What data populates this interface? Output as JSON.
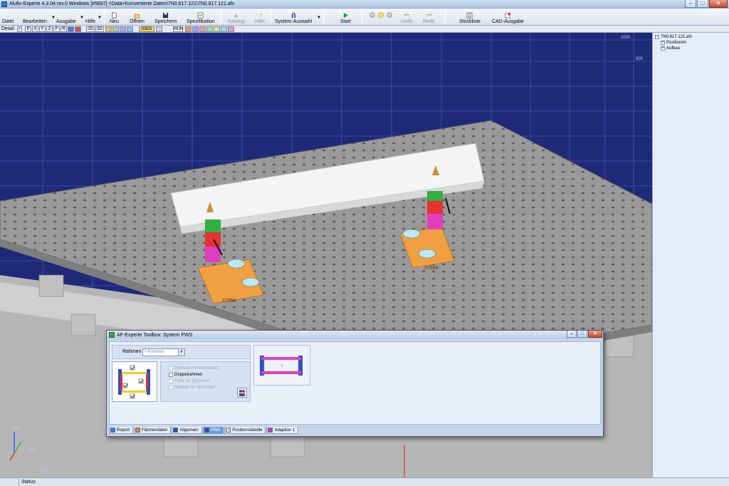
{
  "window": {
    "title": "Alufix-Experte 4.3.04 rev.0 Windows [#5687] <Data>Konvertierte Daten\\7N0.817.121\\7N0.817.121.afx",
    "minimize": "–",
    "maximize": "□",
    "close": "✕"
  },
  "menu": {
    "datei": "Datei",
    "bearbeiten": "Bearbeiten",
    "ausgabe": "Ausgabe",
    "hilfe_menu": "Hilfe",
    "neu": "Neu",
    "offnen": "Öffnen",
    "speichern": "Speichern",
    "spezifikation": "Spezifikation",
    "katalog": "Katalog",
    "hilfe": "Hilfe",
    "system_auswahl": "System-Auswahl",
    "start": "Start",
    "undo": "Undo",
    "redo": "Redo",
    "stueckliste": "Stückliste",
    "cad_ausgabe": "CAD-Ausgabe"
  },
  "toolbar2": {
    "detail_label": "Detail",
    "buttons": [
      "P",
      "X",
      "Y",
      "Z",
      "F",
      "R",
      "2D",
      "3D",
      "IGES",
      "NGN"
    ]
  },
  "viewport": {
    "axis_labels": [
      "1000",
      "900",
      "1200",
      "1800",
      "800"
    ],
    "part_labels": [
      "27050",
      "27050"
    ]
  },
  "tree": {
    "root": "7N0.817.121.afx",
    "children": [
      "Positionen",
      "Aufbau"
    ]
  },
  "dialog": {
    "title": "AF-Experte Toolbox: System PWS",
    "rahmen_label": "Rahmen",
    "rahmen_value": "I-Rahmen",
    "options": [
      {
        "label": "Dreifach mit verbunden",
        "checked": false,
        "enabled": false
      },
      {
        "label": "Doppelrahmen",
        "checked": false,
        "enabled": true
      },
      {
        "label": "Füße an Sprossen",
        "checked": false,
        "enabled": false
      },
      {
        "label": "Streben an Sprossen",
        "checked": false,
        "enabled": false
      }
    ],
    "tabs": [
      {
        "label": "Report",
        "active": false
      },
      {
        "label": "Flächendaten",
        "active": false
      },
      {
        "label": "Allgemein",
        "active": false
      },
      {
        "label": "PWS",
        "active": true
      },
      {
        "label": "Positionstabelle",
        "active": false
      },
      {
        "label": "Adaption 1",
        "active": false
      }
    ]
  },
  "status": {
    "text": "Status"
  },
  "colors": {
    "viewport_bg": "#1e2a78",
    "grid_line": "#4a5ab0",
    "plate": "#9a9a9a",
    "fixture_orange": "#f0a040",
    "accent_tab": "#6a9ee0"
  }
}
